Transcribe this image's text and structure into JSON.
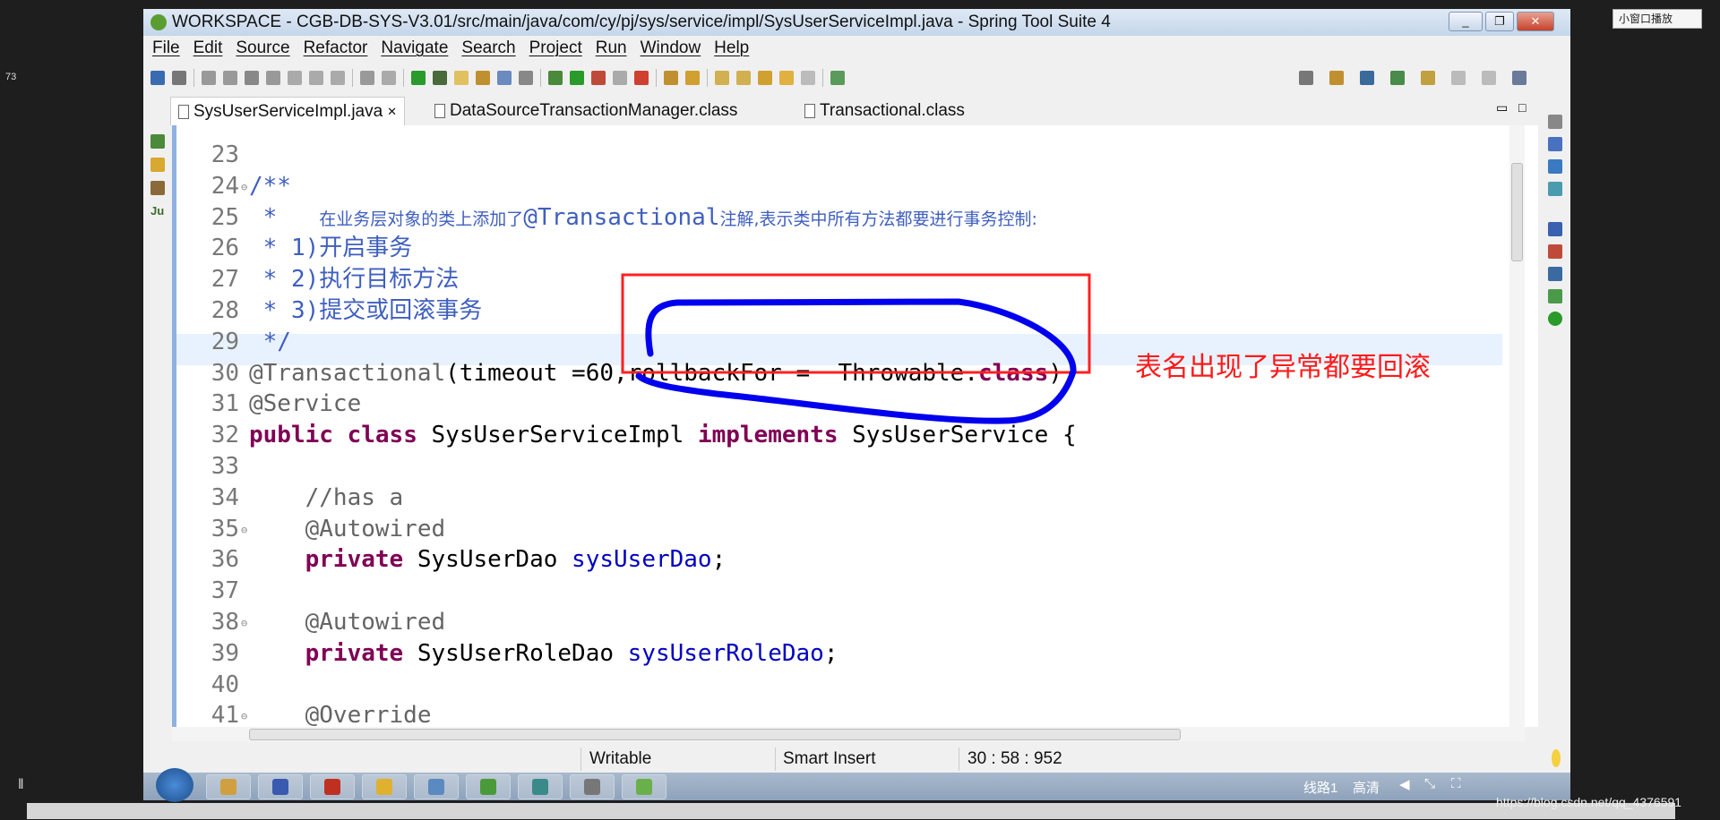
{
  "window": {
    "title": "WORKSPACE - CGB-DB-SYS-V3.01/src/main/java/com/cy/pj/sys/service/impl/SysUserServiceImpl.java - Spring Tool Suite 4"
  },
  "side_number": "73",
  "menu": [
    "File",
    "Edit",
    "Source",
    "Refactor",
    "Navigate",
    "Search",
    "Project",
    "Run",
    "Window",
    "Help"
  ],
  "tabs": [
    {
      "label": "SysUserServiceImpl.java",
      "active": true,
      "close": "✕"
    },
    {
      "label": "DataSourceTransactionManager.class"
    },
    {
      "label": "Transactional.class"
    }
  ],
  "code_lines": [
    {
      "n": "23",
      "parts": []
    },
    {
      "n": "24",
      "fold": true,
      "parts": [
        {
          "t": "/**",
          "c": "cm"
        }
      ]
    },
    {
      "n": "25",
      "parts": [
        {
          "t": " *   ",
          "c": "cm"
        },
        {
          "t": "在业务层对象的类上添加了",
          "c": "cm small"
        },
        {
          "t": "@Transactional",
          "c": "cm"
        },
        {
          "t": "注解,表示类中所有方法都要进行事务控制:",
          "c": "cm small"
        }
      ]
    },
    {
      "n": "26",
      "parts": [
        {
          "t": " * 1)",
          "c": "cm"
        },
        {
          "t": "开启事务",
          "c": "cm big"
        }
      ]
    },
    {
      "n": "27",
      "parts": [
        {
          "t": " * 2)",
          "c": "cm"
        },
        {
          "t": "执行目标方法",
          "c": "cm big"
        }
      ]
    },
    {
      "n": "28",
      "parts": [
        {
          "t": " * 3)",
          "c": "cm"
        },
        {
          "t": "提交或回滚事务",
          "c": "cm big"
        }
      ]
    },
    {
      "n": "29",
      "parts": [
        {
          "t": " */",
          "c": "cm"
        }
      ]
    },
    {
      "n": "30",
      "parts": [
        {
          "t": "@Transactional",
          "c": "an"
        },
        {
          "t": "(timeout =60,rollbackFor =  Throwable.",
          "c": ""
        },
        {
          "t": "class",
          "c": "kw"
        },
        {
          "t": ")",
          "c": ""
        }
      ]
    },
    {
      "n": "31",
      "parts": [
        {
          "t": "@Service",
          "c": "an"
        }
      ]
    },
    {
      "n": "32",
      "parts": [
        {
          "t": "public",
          "c": "kw"
        },
        {
          "t": " ",
          "c": ""
        },
        {
          "t": "class",
          "c": "kw"
        },
        {
          "t": " SysUserServiceImpl ",
          "c": ""
        },
        {
          "t": "implements",
          "c": "kw"
        },
        {
          "t": " SysUserService {",
          "c": ""
        }
      ]
    },
    {
      "n": "33",
      "parts": []
    },
    {
      "n": "34",
      "parts": [
        {
          "t": "    //has a",
          "c": "an"
        }
      ]
    },
    {
      "n": "35",
      "fold": true,
      "parts": [
        {
          "t": "    @Autowired",
          "c": "an"
        }
      ]
    },
    {
      "n": "36",
      "parts": [
        {
          "t": "    ",
          "c": ""
        },
        {
          "t": "private",
          "c": "kw"
        },
        {
          "t": " SysUserDao ",
          "c": ""
        },
        {
          "t": "sysUserDao",
          "c": "fd"
        },
        {
          "t": ";",
          "c": ""
        }
      ]
    },
    {
      "n": "37",
      "parts": []
    },
    {
      "n": "38",
      "fold": true,
      "parts": [
        {
          "t": "    @Autowired",
          "c": "an"
        }
      ]
    },
    {
      "n": "39",
      "parts": [
        {
          "t": "    ",
          "c": ""
        },
        {
          "t": "private",
          "c": "kw"
        },
        {
          "t": " SysUserRoleDao ",
          "c": ""
        },
        {
          "t": "sysUserRoleDao",
          "c": "fd"
        },
        {
          "t": ";",
          "c": ""
        }
      ]
    },
    {
      "n": "40",
      "parts": []
    },
    {
      "n": "41",
      "fold": true,
      "parts": [
        {
          "t": "    @Override",
          "c": "an"
        }
      ]
    }
  ],
  "annotation": {
    "text": "表名出现了异常都要回滚",
    "color": "#ff1a1a",
    "box_color": "#ff2020",
    "ink_color": "#0000ee"
  },
  "status": {
    "writable": "Writable",
    "insert_mode": "Smart Insert",
    "position": "30 : 58 : 952"
  },
  "overlay": {
    "small_window": "小窗口播放",
    "quality": "高清",
    "line": "线路1",
    "watermark": "https://blog.csdn.net/qq_4376591"
  },
  "colors": {
    "comment": "#3f5fbf",
    "annotation": "#646464",
    "keyword": "#7f0055",
    "field": "#0000c0"
  }
}
